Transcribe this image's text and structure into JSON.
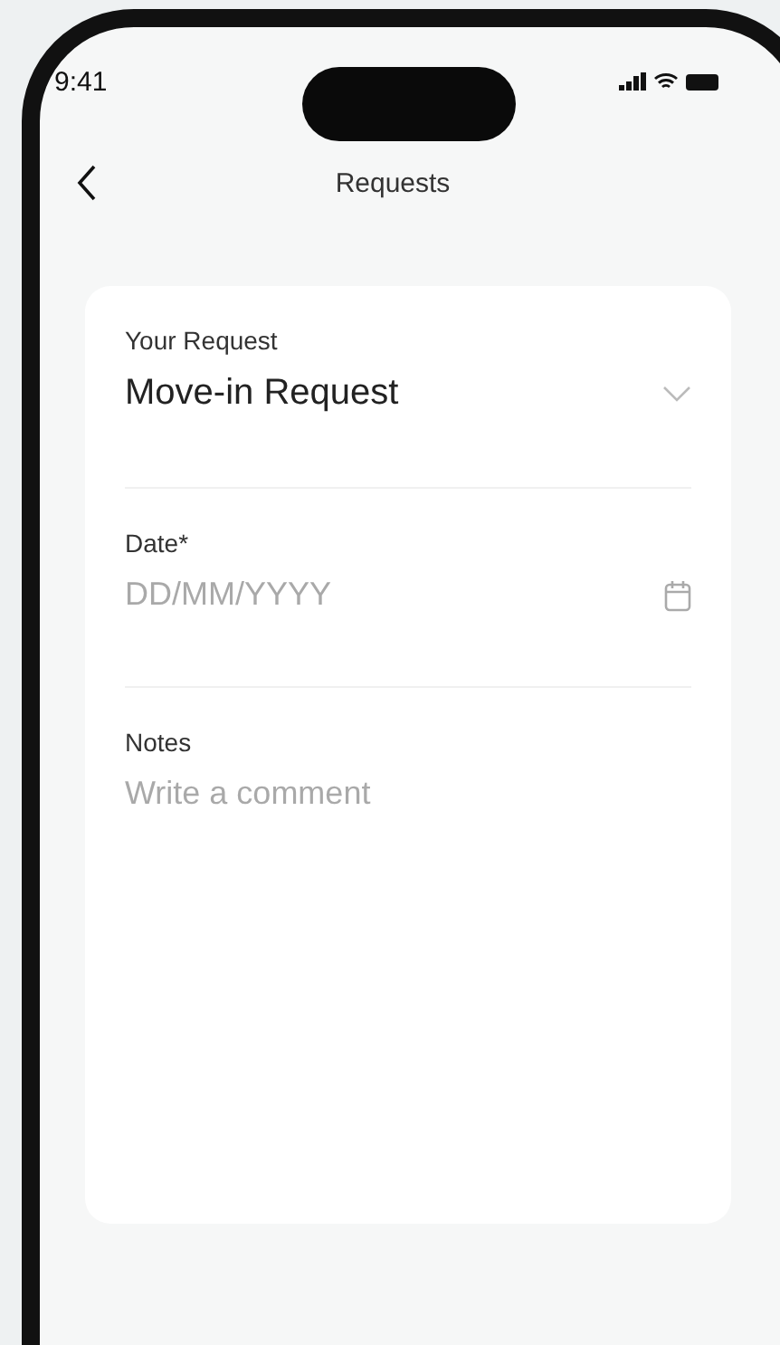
{
  "status_bar": {
    "time": "9:41"
  },
  "nav": {
    "title": "Requests"
  },
  "form": {
    "fields": [
      {
        "kind": "select",
        "label": "Your Request",
        "value": "Move-in Request"
      },
      {
        "kind": "date",
        "label": "Date*",
        "placeholder": "DD/MM/YYYY"
      },
      {
        "kind": "textarea",
        "label": "Notes",
        "placeholder": "Write a comment"
      }
    ]
  }
}
